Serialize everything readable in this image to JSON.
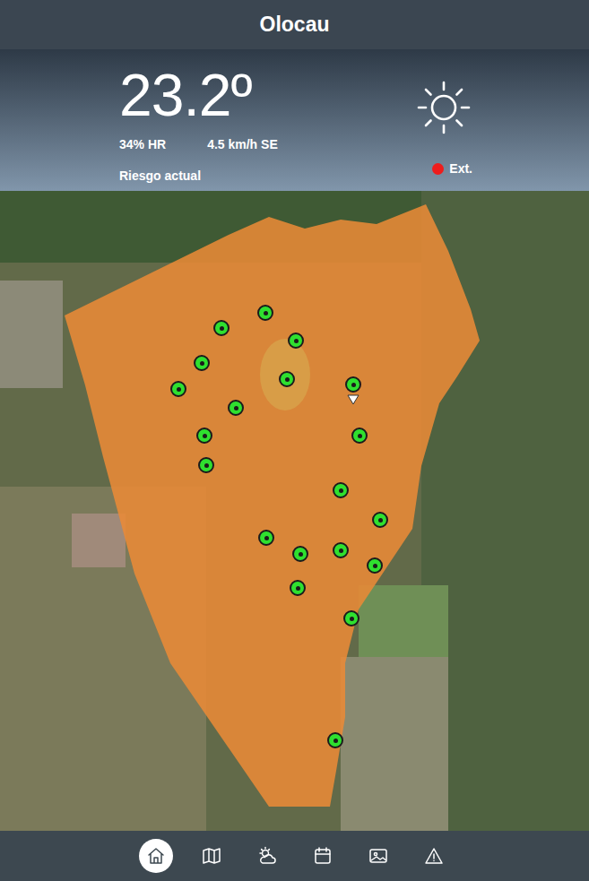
{
  "header": {
    "title": "Olocau"
  },
  "weather": {
    "temperature": "23.2º",
    "humidity": "34% HR",
    "wind": "4.5 km/h SE"
  },
  "risk": {
    "label": "Riesgo actual",
    "value": "Ext.",
    "color": "#ee1c1c"
  },
  "nav": [
    {
      "kind": "home",
      "selected": true
    },
    {
      "kind": "map",
      "selected": false
    },
    {
      "kind": "weather",
      "selected": false
    },
    {
      "kind": "calendar",
      "selected": false
    },
    {
      "kind": "gallery",
      "selected": false
    },
    {
      "kind": "alert",
      "selected": false
    }
  ]
}
